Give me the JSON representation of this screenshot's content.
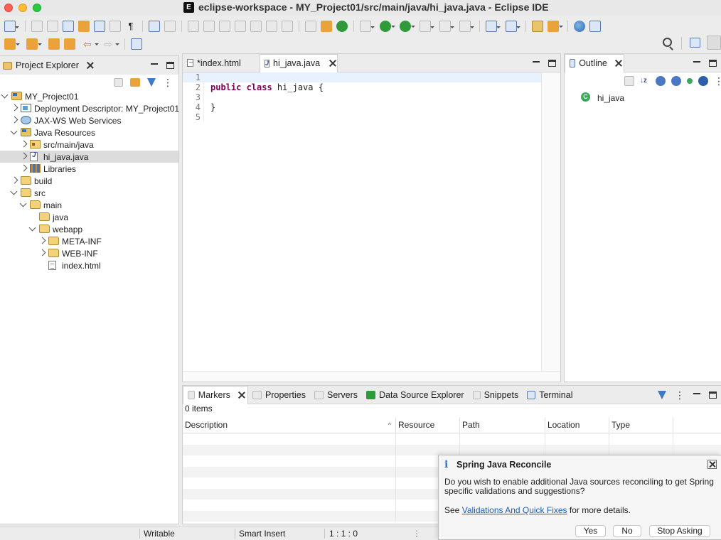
{
  "window": {
    "title": "eclipse-workspace - MY_Project01/src/main/java/hi_java.java - Eclipse IDE",
    "app_icon": "eclipse-icon"
  },
  "explorer": {
    "tab_label": "Project Explorer",
    "tree": [
      {
        "label": "MY_Project01",
        "indent": 0,
        "chevron": "down",
        "icon": "project-icon"
      },
      {
        "label": "Deployment Descriptor: MY_Project01",
        "indent": 1,
        "chevron": "right",
        "icon": "deployment-descriptor-icon"
      },
      {
        "label": "JAX-WS Web Services",
        "indent": 1,
        "chevron": "right",
        "icon": "web-services-icon"
      },
      {
        "label": "Java Resources",
        "indent": 1,
        "chevron": "down",
        "icon": "java-resources-icon"
      },
      {
        "label": "src/main/java",
        "indent": 2,
        "chevron": "right",
        "icon": "source-folder-icon"
      },
      {
        "label": "hi_java.java",
        "indent": 2,
        "chevron": "right",
        "icon": "java-file-icon",
        "selected": true
      },
      {
        "label": "Libraries",
        "indent": 2,
        "chevron": "right",
        "icon": "libraries-icon"
      },
      {
        "label": "build",
        "indent": 1,
        "chevron": "right",
        "icon": "folder-icon"
      },
      {
        "label": "src",
        "indent": 1,
        "chevron": "down",
        "icon": "folder-icon"
      },
      {
        "label": "main",
        "indent": 2,
        "chevron": "down",
        "icon": "folder-icon"
      },
      {
        "label": "java",
        "indent": 3,
        "chevron": "",
        "icon": "folder-icon"
      },
      {
        "label": "webapp",
        "indent": 3,
        "chevron": "down",
        "icon": "folder-icon"
      },
      {
        "label": "META-INF",
        "indent": 4,
        "chevron": "right",
        "icon": "folder-icon"
      },
      {
        "label": "WEB-INF",
        "indent": 4,
        "chevron": "right",
        "icon": "folder-icon"
      },
      {
        "label": "index.html",
        "indent": 4,
        "chevron": "",
        "icon": "html-file-icon"
      }
    ]
  },
  "editor": {
    "tabs": [
      {
        "label": "*index.html",
        "active": false
      },
      {
        "label": "hi_java.java",
        "active": true
      }
    ],
    "lines": [
      {
        "num": "1",
        "kw": "",
        "text": ""
      },
      {
        "num": "2",
        "kw": "public class",
        "text": " hi_java {"
      },
      {
        "num": "3",
        "kw": "",
        "text": ""
      },
      {
        "num": "4",
        "kw": "",
        "text": "}"
      },
      {
        "num": "5",
        "kw": "",
        "text": ""
      }
    ]
  },
  "outline": {
    "tab_label": "Outline",
    "item": "hi_java"
  },
  "bottom": {
    "tabs": [
      "Markers",
      "Properties",
      "Servers",
      "Data Source Explorer",
      "Snippets",
      "Terminal"
    ],
    "count": "0 items",
    "columns": [
      "Description",
      "Resource",
      "Path",
      "Location",
      "Type"
    ]
  },
  "status": {
    "writable": "Writable",
    "insert_mode": "Smart Insert",
    "position": "1 : 1 : 0"
  },
  "popup": {
    "title": "Spring Java Reconcile",
    "message": "Do you wish to enable additional Java sources reconciling to get Spring specific validations and suggestions?",
    "see_prefix": "See",
    "link": "Validations And Quick Fixes",
    "see_suffix": "for more details.",
    "yes": "Yes",
    "no": "No",
    "stop": "Stop Asking"
  },
  "colors": {
    "keyword": "#7f0055",
    "link": "#1a5db8",
    "selection": "#dcdcdc",
    "current_line": "#e8f2fe"
  }
}
